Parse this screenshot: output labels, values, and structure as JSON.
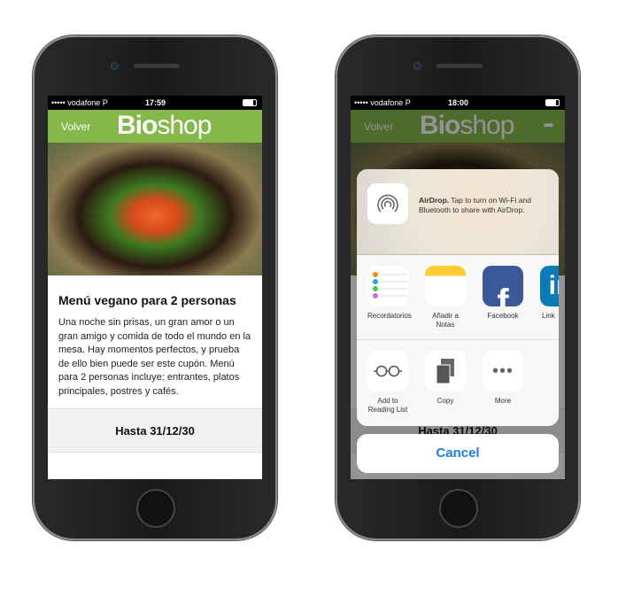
{
  "status_left": {
    "carrier": "••••• vodafone P",
    "time": "17:59"
  },
  "status_right": {
    "carrier": "••••• vodafone P",
    "time": "18:00"
  },
  "nav": {
    "back": "Volver",
    "logo_bold": "Bio",
    "logo_light": "shop",
    "share_icon": "share-arrow-icon"
  },
  "brand_color": "#85b84a",
  "offer": {
    "title": "Menú vegano para 2 personas",
    "description": "Una noche sin prisas, un gran amor o un gran amigo y comida de todo el mundo en la mesa. Hay momentos perfectos, y prueba de ello bien puede ser este cupón. Menú para 2 personas incluye: entrantes, platos principales, postres y cafés.",
    "expiry": "Hasta 31/12/30"
  },
  "share_sheet": {
    "airdrop_title": "AirDrop.",
    "airdrop_text": " Tap to turn on Wi-Fi and Bluetooth to share with AirDrop.",
    "apps": [
      {
        "label": "Recordatorios"
      },
      {
        "label": "Añadir a Notas"
      },
      {
        "label": "Facebook"
      },
      {
        "label": "Link"
      }
    ],
    "actions": [
      {
        "label": "Add to Reading List"
      },
      {
        "label": "Copy"
      },
      {
        "label": "More"
      }
    ],
    "cancel": "Cancel"
  }
}
